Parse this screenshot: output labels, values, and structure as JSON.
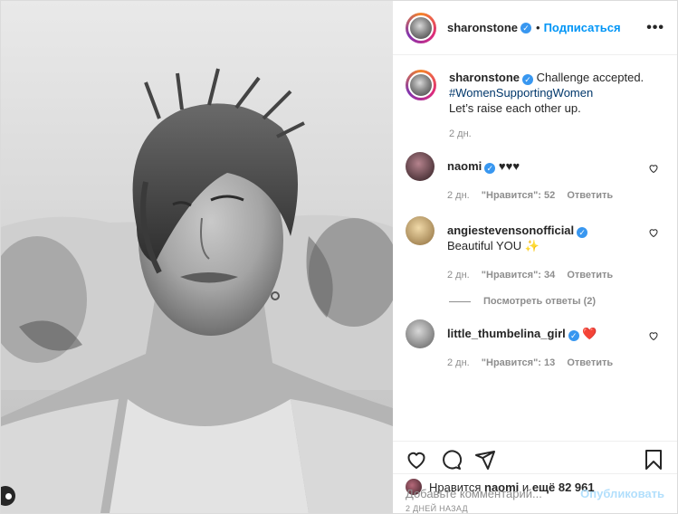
{
  "post": {
    "author": "sharonstone",
    "follow_label": "Подписаться",
    "dot": "•",
    "more_label": "•••"
  },
  "caption": {
    "username": "sharonstone",
    "text": "Challenge accepted.",
    "hashtag": "#WomenSupportingWomen",
    "line2": "Let’s raise each other up.",
    "time": "2 дн."
  },
  "comments": [
    {
      "username": "naomi",
      "verified": true,
      "text": "♥♥♥",
      "time": "2 дн.",
      "likes": "\"Нравится\": 52",
      "reply": "Ответить"
    },
    {
      "username": "angiestevensonofficial",
      "verified": true,
      "text": "Beautiful YOU ✨",
      "time": "2 дн.",
      "likes": "\"Нравится\": 34",
      "reply": "Ответить"
    },
    {
      "username": "little_thumbelina_girl",
      "verified": true,
      "text": "❤️",
      "time": "2 дн.",
      "likes": "\"Нравится\": 13",
      "reply": "Ответить"
    }
  ],
  "view_replies": "Посмотреть ответы (2)",
  "likes": {
    "prefix": "Нравится",
    "user": "naomi",
    "conj": "и",
    "others": "ещё 82 961"
  },
  "date": "2 ДНЕЙ НАЗАД",
  "comment_box": {
    "placeholder": "Добавьте комментарий...",
    "publish": "Опубликовать"
  },
  "colors": {
    "accent": "#0095f6",
    "verified": "#3897f0",
    "secondary_text": "#8e8e8e"
  },
  "icons": [
    "heart-icon",
    "comment-icon",
    "share-icon",
    "bookmark-icon",
    "more-icon",
    "verified-icon"
  ]
}
